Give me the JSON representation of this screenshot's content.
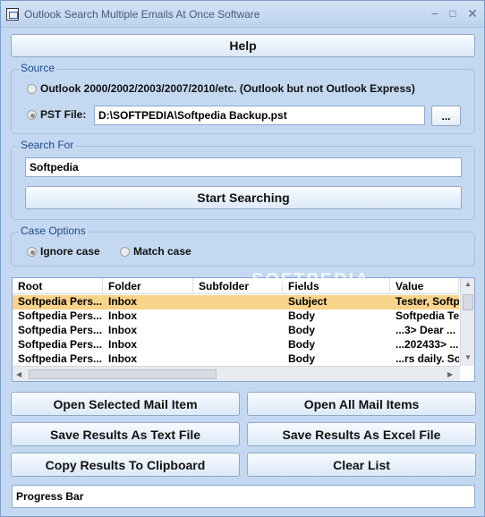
{
  "window": {
    "title": "Outlook Search Multiple Emails At Once Software",
    "icon": "app-window-icon"
  },
  "help": {
    "label": "Help"
  },
  "source": {
    "legend": "Source",
    "option_outlook": "Outlook 2000/2002/2003/2007/2010/etc. (Outlook but not Outlook Express)",
    "option_pst": "PST File:",
    "selected": "pst",
    "pst_path": "D:\\SOFTPEDIA\\Softpedia Backup.pst",
    "browse_label": "..."
  },
  "search": {
    "legend": "Search For",
    "value": "Softpedia",
    "start_label": "Start Searching"
  },
  "case": {
    "legend": "Case Options",
    "ignore_label": "Ignore case",
    "match_label": "Match case",
    "selected": "ignore"
  },
  "results": {
    "columns": [
      "Root",
      "Folder",
      "Subfolder",
      "Fields",
      "Value"
    ],
    "rows": [
      [
        "Softpedia Pers...",
        "Inbox",
        "",
        "Subject",
        "Tester, Softp"
      ],
      [
        "Softpedia Pers...",
        "Inbox",
        "",
        "Body",
        "Softpedia Te"
      ],
      [
        "Softpedia Pers...",
        "Inbox",
        "",
        "Body",
        "...3> Dear ..."
      ],
      [
        "Softpedia Pers...",
        "Inbox",
        "",
        "Body",
        "...202433> ..."
      ],
      [
        "Softpedia Pers...",
        "Inbox",
        "",
        "Body",
        "...rs daily. So"
      ]
    ],
    "selected_row": 0,
    "watermark": "SOFTPEDIA"
  },
  "actions": {
    "open_selected": "Open Selected Mail Item",
    "open_all": "Open All Mail Items",
    "save_text": "Save Results As Text File",
    "save_excel": "Save Results As Excel File",
    "copy_clipboard": "Copy Results To Clipboard",
    "clear_list": "Clear List"
  },
  "status": {
    "progress_label": "Progress Bar"
  },
  "colors": {
    "window_bg": "#c4d9f1",
    "group_legend": "#1e4a88",
    "selected_row": "#f8d38a",
    "button_border": "#91a8c8"
  }
}
